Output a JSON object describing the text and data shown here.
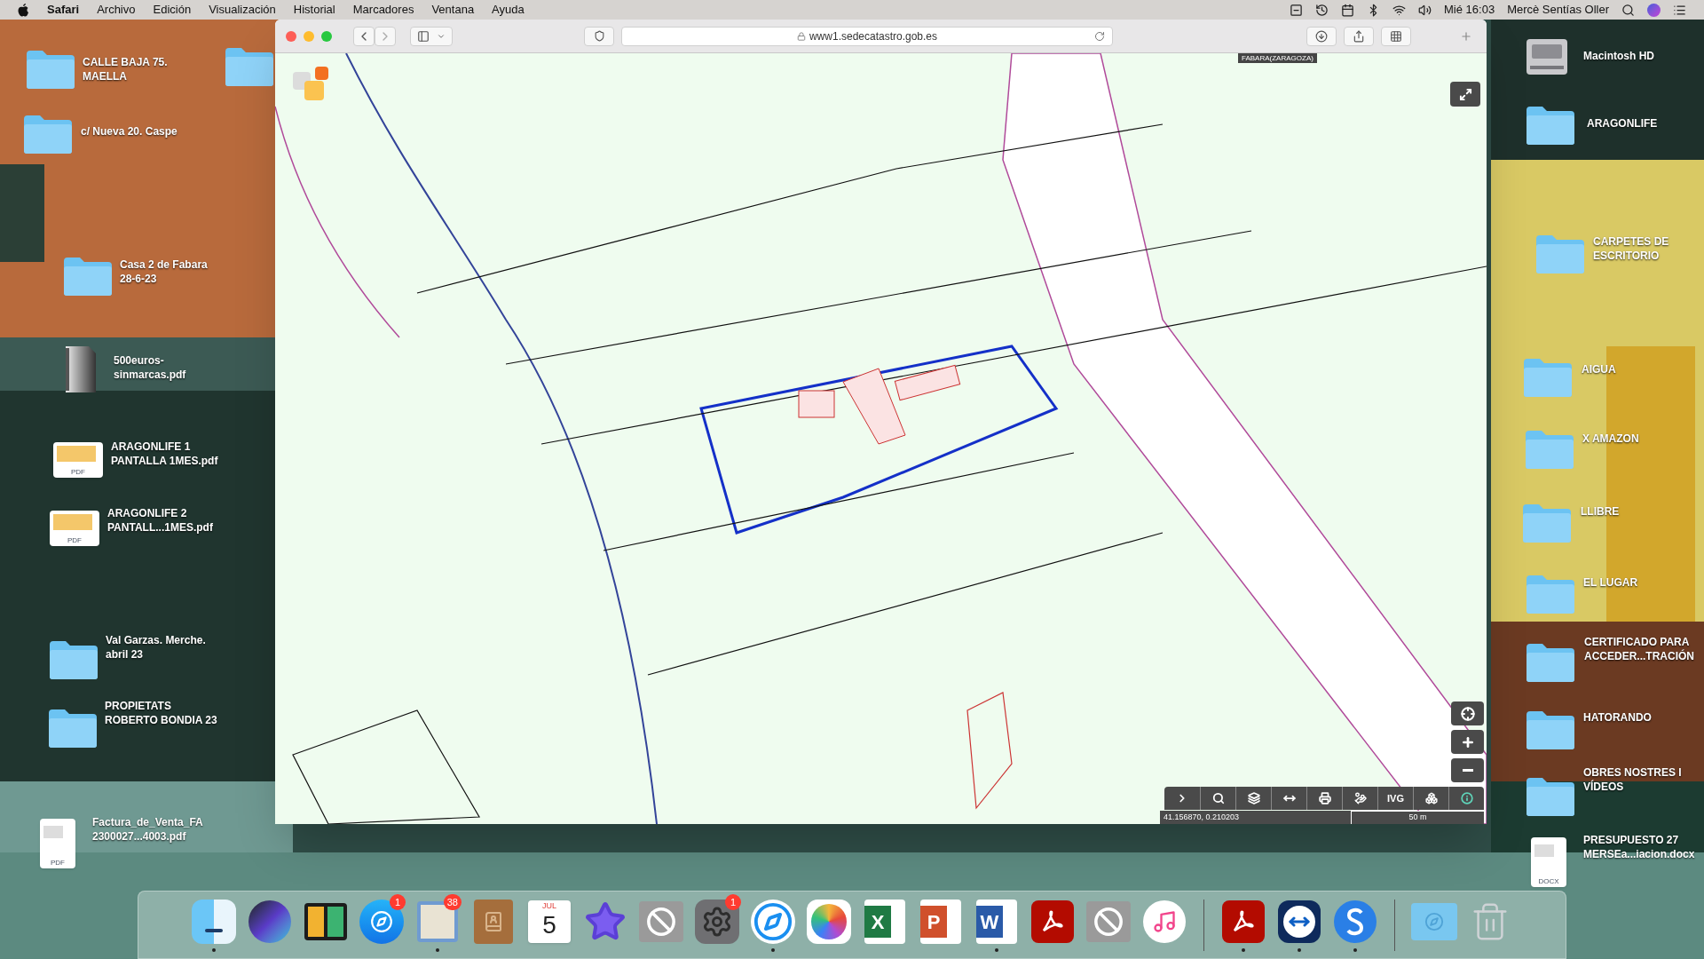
{
  "menu_bar": {
    "app": "Safari",
    "menus": [
      "Archivo",
      "Edición",
      "Visualización",
      "Historial",
      "Marcadores",
      "Ventana",
      "Ayuda"
    ],
    "clock": "Mié 16:03",
    "user": "Mercè Sentías Oller"
  },
  "browser": {
    "address": "www1.sedecatastro.gob.es",
    "map": {
      "kind": "picture",
      "region_label": "FABARA(ZARAGOZA)",
      "zoom_controls": [
        {
          "kind": "locate"
        },
        {
          "kind": "zoom_in"
        },
        {
          "kind": "zoom_out"
        }
      ],
      "tools": [
        {
          "kind": "expand"
        },
        {
          "kind": "search"
        },
        {
          "kind": "layers"
        },
        {
          "kind": "measure"
        },
        {
          "kind": "print"
        },
        {
          "kind": "parking"
        },
        {
          "kind": "text",
          "label": "IVG"
        },
        {
          "kind": "cubes"
        },
        {
          "kind": "info"
        }
      ],
      "coordinates": "41.156870, 0.210203",
      "scale": "50 m"
    }
  },
  "desktop_left": [
    {
      "kind": "folder",
      "lines": [
        "CALLE BAJA 75.",
        "MAELLA"
      ]
    },
    {
      "kind": "folder"
    },
    {
      "kind": "folder",
      "lines": [
        "c/ Nueva 20. Caspe"
      ]
    },
    {
      "kind": "folder",
      "lines": [
        "Casa 2 de Fabara",
        "28-6-23"
      ]
    },
    {
      "kind": "binder",
      "lines": [
        "500euros-",
        "sinmarcas.pdf"
      ]
    },
    {
      "kind": "document",
      "tag": "PDF",
      "lines": [
        "ARAGONLIFE 1",
        "PANTALLA 1MES.pdf"
      ]
    },
    {
      "kind": "document",
      "tag": "PDF",
      "lines": [
        "ARAGONLIFE 2",
        "PANTALL...1MES.pdf"
      ]
    },
    {
      "kind": "folder",
      "lines": [
        "Val Garzas. Merche.",
        "abril 23"
      ]
    },
    {
      "kind": "folder",
      "lines": [
        "PROPIETATS",
        "ROBERTO BONDIA 23"
      ]
    },
    {
      "kind": "sheet",
      "tag": "PDF",
      "lines": [
        "Factura_de_Venta_FA",
        "2300027...4003.pdf"
      ]
    }
  ],
  "desktop_right": [
    {
      "kind": "disk",
      "lines": [
        "Macintosh HD"
      ]
    },
    {
      "kind": "folder",
      "lines": [
        "ARAGONLIFE"
      ]
    },
    {
      "kind": "folder",
      "lines": [
        "CARPETES DE",
        "ESCRITORIO"
      ]
    },
    {
      "kind": "folder",
      "lines": [
        "AIGUA"
      ]
    },
    {
      "kind": "folder",
      "lines": [
        "X AMAZON"
      ]
    },
    {
      "kind": "folder",
      "lines": [
        "LLIBRE"
      ]
    },
    {
      "kind": "folder",
      "lines": [
        "EL LUGAR"
      ]
    },
    {
      "kind": "folder",
      "lines": [
        "CERTIFICADO PARA",
        "ACCEDER...TRACIÓN"
      ]
    },
    {
      "kind": "folder",
      "lines": [
        "HATORANDO"
      ]
    },
    {
      "kind": "folder",
      "lines": [
        "OBRES NOSTRES I",
        "VÍDEOS"
      ]
    },
    {
      "kind": "sheet",
      "tag": "DOCX",
      "lines": [
        "PRESUPUESTO 27",
        "MERSEa...iacion.docx"
      ]
    }
  ],
  "dock": [
    {
      "kind": "finder",
      "running": true
    },
    {
      "kind": "siri",
      "running": false
    },
    {
      "kind": "monitor",
      "running": false
    },
    {
      "kind": "appstore",
      "running": false,
      "badge": "1"
    },
    {
      "kind": "mail",
      "running": true,
      "badge": "38"
    },
    {
      "kind": "contacts",
      "running": false
    },
    {
      "kind": "calendar",
      "running": false,
      "month": "JUL",
      "day": "5"
    },
    {
      "kind": "star",
      "running": false
    },
    {
      "kind": "blocked",
      "running": false
    },
    {
      "kind": "settings",
      "running": false,
      "badge": "1"
    },
    {
      "kind": "safari",
      "running": true
    },
    {
      "kind": "photos",
      "running": false
    },
    {
      "kind": "letter",
      "running": false,
      "glyph": "X",
      "color": "#1f7a44"
    },
    {
      "kind": "letter",
      "running": false,
      "glyph": "P",
      "color": "#d0502c"
    },
    {
      "kind": "letter",
      "running": true,
      "glyph": "W",
      "color": "#2a5aa8"
    },
    {
      "kind": "acrobat",
      "running": false
    },
    {
      "kind": "blocked",
      "running": false
    },
    {
      "kind": "music",
      "running": false
    },
    {
      "kind": "separator"
    },
    {
      "kind": "acrobat",
      "running": true
    },
    {
      "kind": "remote",
      "running": true
    },
    {
      "kind": "sapp",
      "running": true
    },
    {
      "kind": "separator"
    },
    {
      "kind": "appfolder",
      "running": false
    },
    {
      "kind": "trash",
      "running": false
    }
  ]
}
